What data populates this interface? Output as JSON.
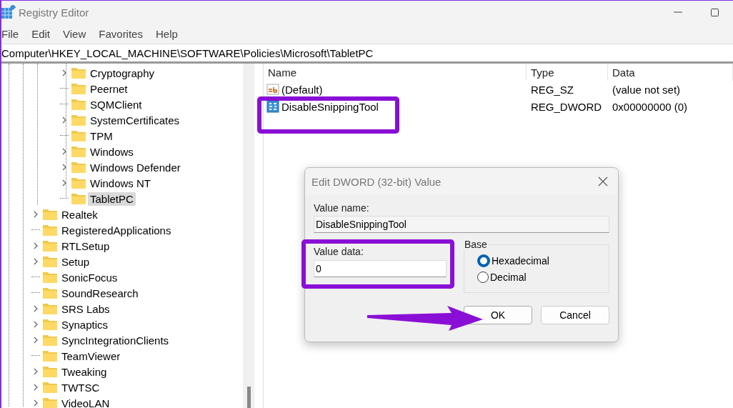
{
  "window": {
    "title": "Registry Editor"
  },
  "menu": [
    "File",
    "Edit",
    "View",
    "Favorites",
    "Help"
  ],
  "address": "Computer\\HKEY_LOCAL_MACHINE\\SOFTWARE\\Policies\\Microsoft\\TabletPC",
  "tree": {
    "items": [
      {
        "children": [
          {
            "label": "Cryptography",
            "expandable": true,
            "selected": false
          },
          {
            "label": "Peernet",
            "expandable": false,
            "selected": false
          },
          {
            "label": "SQMClient",
            "expandable": false,
            "selected": false
          },
          {
            "label": "SystemCertificates",
            "expandable": true,
            "selected": false
          },
          {
            "label": "TPM",
            "expandable": false,
            "selected": false
          },
          {
            "label": "Windows",
            "expandable": true,
            "selected": false
          },
          {
            "label": "Windows Defender",
            "expandable": true,
            "selected": false
          },
          {
            "label": "Windows NT",
            "expandable": true,
            "selected": false
          },
          {
            "label": "TabletPC",
            "expandable": false,
            "selected": true
          }
        ]
      },
      {
        "label": "Realtek",
        "expandable": true,
        "selected": false
      },
      {
        "label": "RegisteredApplications",
        "expandable": false,
        "selected": false
      },
      {
        "label": "RTLSetup",
        "expandable": true,
        "selected": false
      },
      {
        "label": "Setup",
        "expandable": true,
        "selected": false
      },
      {
        "label": "SonicFocus",
        "expandable": false,
        "selected": false
      },
      {
        "label": "SoundResearch",
        "expandable": false,
        "selected": false
      },
      {
        "label": "SRS Labs",
        "expandable": true,
        "selected": false
      },
      {
        "label": "Synaptics",
        "expandable": true,
        "selected": false
      },
      {
        "label": "SyncIntegrationClients",
        "expandable": true,
        "selected": false
      },
      {
        "label": "TeamViewer",
        "expandable": false,
        "selected": false
      },
      {
        "label": "Tweaking",
        "expandable": true,
        "selected": false
      },
      {
        "label": "TWTSC",
        "expandable": true,
        "selected": false
      },
      {
        "label": "VideoLAN",
        "expandable": true,
        "selected": false
      }
    ]
  },
  "values": {
    "columns": [
      "Name",
      "Type",
      "Data"
    ],
    "rows": [
      {
        "kind": "string",
        "name": "(Default)",
        "type": "REG_SZ",
        "data": "(value not set)",
        "highlighted": false
      },
      {
        "kind": "binary",
        "name": "DisableSnippingTool",
        "type": "REG_DWORD",
        "data": "0x00000000 (0)",
        "highlighted": true
      }
    ]
  },
  "dialog": {
    "title": "Edit DWORD (32-bit) Value",
    "value_name_label": "Value name:",
    "value_name": "DisableSnippingTool",
    "value_data_label": "Value data:",
    "value_data": "0",
    "value_data_highlighted": true,
    "base_label": "Base",
    "base_options": [
      {
        "label": "Hexadecimal",
        "selected": true
      },
      {
        "label": "Decimal",
        "selected": false
      }
    ],
    "buttons": [
      {
        "label": "OK",
        "pointed": true
      },
      {
        "label": "Cancel",
        "pointed": false
      }
    ]
  }
}
